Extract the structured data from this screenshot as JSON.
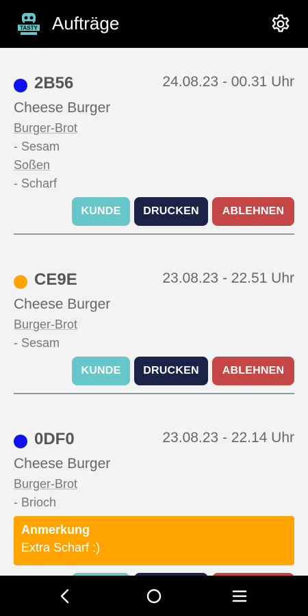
{
  "appbar": {
    "title": "Aufträge",
    "logo_icon": "tasty-logo-icon",
    "settings_icon": "gear-icon"
  },
  "labels": {
    "kunde": "KUNDE",
    "drucken": "DRUCKEN",
    "ablehnen": "ABLEHNEN"
  },
  "orders": [
    {
      "code": "2B56",
      "status_color": "#1111ee",
      "datetime": "24.08.23 - 00.31 Uhr",
      "item": "Cheese Burger",
      "options": [
        {
          "title": "Burger-Brot",
          "value": "- Sesam"
        },
        {
          "title": "Soßen",
          "value": "- Scharf"
        }
      ]
    },
    {
      "code": "CE9E",
      "status_color": "#ffa300",
      "datetime": "23.08.23 - 22.51 Uhr",
      "item": "Cheese Burger",
      "options": [
        {
          "title": "Burger-Brot",
          "value": "- Sesam"
        }
      ]
    },
    {
      "code": "0DF0",
      "status_color": "#1111ee",
      "datetime": "23.08.23 - 22.14 Uhr",
      "item": "Cheese Burger",
      "options": [
        {
          "title": "Burger-Brot",
          "value": "- Brioch"
        }
      ],
      "note": {
        "title": "Anmerkung",
        "text": "Extra Scharf :)"
      }
    }
  ],
  "navbar": {
    "back_icon": "back-icon",
    "home_icon": "home-icon",
    "recents_icon": "recents-icon"
  }
}
